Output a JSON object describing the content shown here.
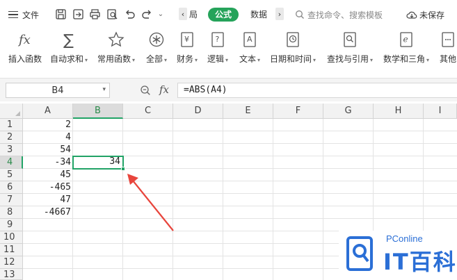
{
  "topbar": {
    "menu_label": "文件",
    "tabs": {
      "prev": "局",
      "active": "公式",
      "next": "数据"
    },
    "search_label": "查找命令、搜索模板",
    "save_label": "未保存"
  },
  "ribbon": {
    "buttons": [
      {
        "label": "插入函数",
        "dropdown": ""
      },
      {
        "label": "自动求和",
        "dropdown": "▾"
      },
      {
        "label": "常用函数",
        "dropdown": "▾"
      },
      {
        "label": "全部",
        "dropdown": "▾"
      },
      {
        "label": "财务",
        "dropdown": "▾"
      },
      {
        "label": "逻辑",
        "dropdown": "▾"
      },
      {
        "label": "文本",
        "dropdown": "▾"
      },
      {
        "label": "日期和时间",
        "dropdown": "▾"
      },
      {
        "label": "查找与引用",
        "dropdown": "▾"
      },
      {
        "label": "数学和三角",
        "dropdown": "▾"
      },
      {
        "label": "其他",
        "dropdown": ""
      }
    ],
    "icon_glyphs": {
      "sum": "∑",
      "yen": "¥",
      "question": "?",
      "text": "A",
      "asterisk": "*"
    }
  },
  "formula_bar": {
    "name_box": "B4",
    "fx_label": "fx",
    "formula": "=ABS(A4)"
  },
  "grid": {
    "columns": [
      "A",
      "B",
      "C",
      "D",
      "E",
      "F",
      "G",
      "H",
      "I"
    ],
    "rows": [
      "1",
      "2",
      "3",
      "4",
      "5",
      "6",
      "7",
      "8",
      "9",
      "10",
      "11",
      "12",
      "13"
    ],
    "selected_column": "B",
    "selected_row": "4",
    "col_a_values": [
      "2",
      "4",
      "54",
      "-34",
      "45",
      "-465",
      "47",
      "-4667"
    ],
    "b4_value": "34"
  },
  "watermark": {
    "brand_small": "PConline",
    "brand_large": "IT百科"
  },
  "colors": {
    "accent_green": "#21a366",
    "tab_green": "#25a35a",
    "arrow_red": "#e8453c",
    "watermark_blue": "#2b6fd6"
  }
}
